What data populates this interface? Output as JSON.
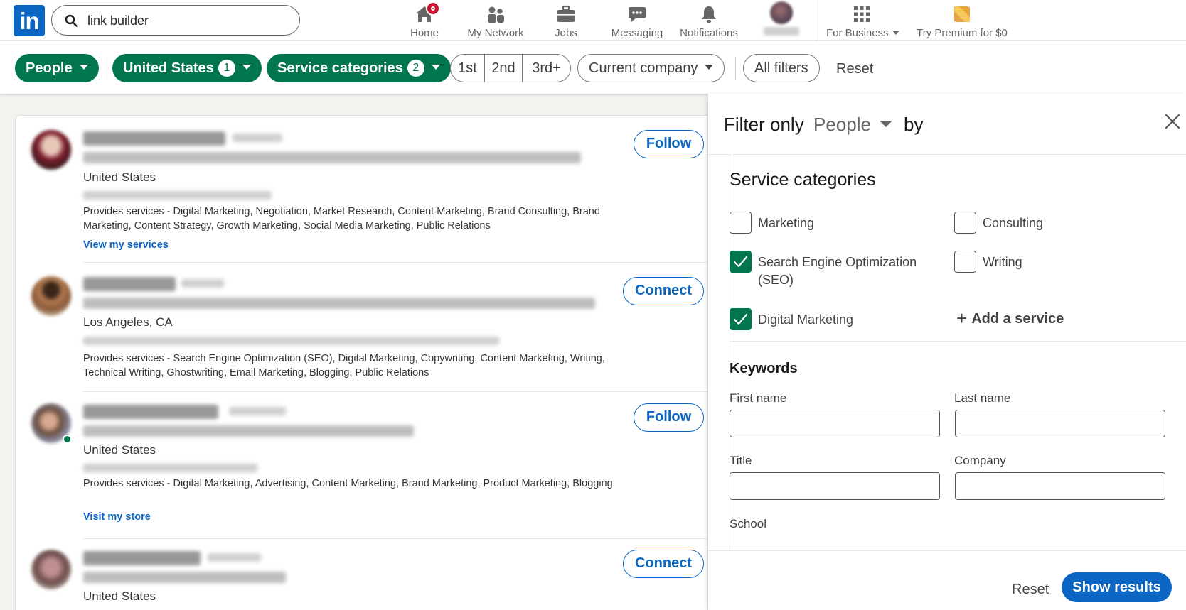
{
  "brand": {
    "logo_text": "in",
    "accent": "#0a66c2",
    "green": "#01754f"
  },
  "search": {
    "value": "link builder",
    "icon": "search-icon"
  },
  "nav": {
    "items": [
      {
        "label": "Home",
        "icon": "home-icon"
      },
      {
        "label": "My Network",
        "icon": "people-icon"
      },
      {
        "label": "Jobs",
        "icon": "briefcase-icon"
      },
      {
        "label": "Messaging",
        "icon": "chat-icon"
      },
      {
        "label": "Notifications",
        "icon": "bell-icon"
      }
    ],
    "business": {
      "label": "For Business",
      "icon": "grid-icon"
    },
    "premium": {
      "label": "Try Premium for $0",
      "icon": "premium-icon"
    }
  },
  "filters": {
    "people": "People",
    "location": {
      "label": "United States",
      "count": "1"
    },
    "service": {
      "label": "Service categories",
      "count": "2"
    },
    "degrees": [
      "1st",
      "2nd",
      "3rd+"
    ],
    "company": "Current company",
    "all": "All filters",
    "reset": "Reset"
  },
  "results": [
    {
      "location": "United States",
      "services": "Provides services - Digital Marketing, Negotiation, Market Research, Content Marketing, Brand Consulting, Brand Marketing, Content Strategy, Growth Marketing, Social Media Marketing, Public Relations",
      "link": "View my services",
      "action": "Follow"
    },
    {
      "location": "Los Angeles, CA",
      "services": "Provides services - Search Engine Optimization (SEO), Digital Marketing, Copywriting, Content Marketing, Writing, Technical Writing, Ghostwriting, Email Marketing, Blogging, Public Relations",
      "link": "",
      "action": "Connect"
    },
    {
      "location": "United States",
      "services": "Provides services - Digital Marketing, Advertising, Content Marketing, Brand Marketing, Product Marketing, Blogging",
      "link": "Visit my store",
      "action": "Follow"
    },
    {
      "location": "United States",
      "services": "",
      "link": "",
      "action": "Connect"
    }
  ],
  "panel": {
    "filter_only": "Filter only",
    "type": "People",
    "by": "by",
    "service_title": "Service categories",
    "categories": [
      {
        "label": "Marketing",
        "checked": false
      },
      {
        "label": "Consulting",
        "checked": false
      },
      {
        "label": "Search Engine Optimization (SEO)",
        "checked": true
      },
      {
        "label": "Writing",
        "checked": false
      },
      {
        "label": "Digital Marketing",
        "checked": true
      }
    ],
    "add_service": "Add a service",
    "keywords_title": "Keywords",
    "fields": {
      "first_name": "First name",
      "last_name": "Last name",
      "title": "Title",
      "company": "Company",
      "school": "School"
    },
    "reset": "Reset",
    "show_results": "Show results"
  }
}
